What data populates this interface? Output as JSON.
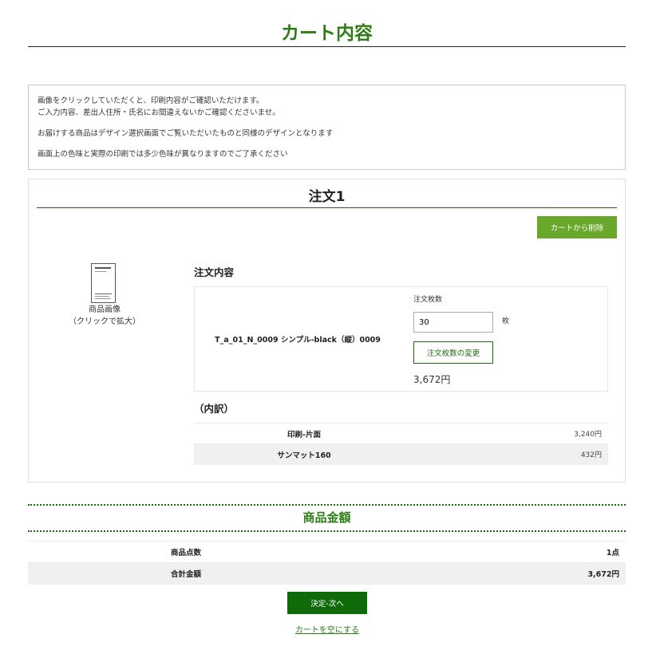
{
  "header": {
    "title": "カート内容"
  },
  "notice": {
    "lines": [
      "画像をクリックしていただくと、印刷内容がご確認いただけます。",
      "ご入力内容、差出人住所・氏名にお間違えないかご確認くださいませ。",
      "お届けする商品はデザイン選択画面でご覧いただいたものと同様のデザインとなります",
      "画面上の色味と実際の印刷では多少色味が異なりますのでご了承ください"
    ]
  },
  "order": {
    "title": "注文1",
    "delete_label": "カートから削除",
    "image_caption_1": "商品画像",
    "image_caption_2": "（クリックで拡大）",
    "details_heading": "注文内容",
    "item_name": "T_a_01_N_0009 シンプル-black（縦）0009",
    "qty_label": "注文枚数",
    "qty_value": "30",
    "qty_unit": "枚",
    "qty_change_label": "注文枚数の変更",
    "price": "3,672円",
    "breakdown_heading": "（内訳）",
    "breakdown": [
      {
        "label": "印刷-片面",
        "value": "3,240円"
      },
      {
        "label": "サンマット160",
        "value": "432円"
      }
    ]
  },
  "totals": {
    "heading": "商品金額",
    "rows": [
      {
        "label": "商品点数",
        "value": "1点"
      },
      {
        "label": "合計金額",
        "value": "3,672円"
      }
    ]
  },
  "actions": {
    "next_label": "決定-次へ",
    "empty_cart_label": "カートを空にする"
  },
  "colors": {
    "accent_green": "#2d7d14",
    "delete_button": "#6aa82c",
    "next_button": "#0f6b0a"
  }
}
